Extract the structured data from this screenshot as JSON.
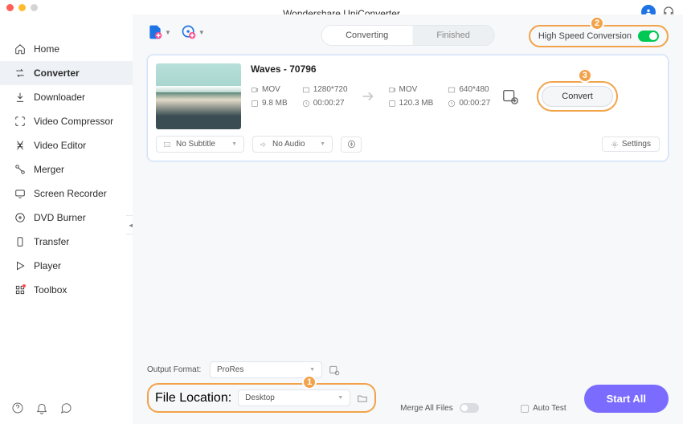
{
  "app": {
    "title": "Wondershare UniConverter"
  },
  "sidebar": {
    "items": [
      {
        "label": "Home"
      },
      {
        "label": "Converter"
      },
      {
        "label": "Downloader"
      },
      {
        "label": "Video Compressor"
      },
      {
        "label": "Video Editor"
      },
      {
        "label": "Merger"
      },
      {
        "label": "Screen Recorder"
      },
      {
        "label": "DVD Burner"
      },
      {
        "label": "Transfer"
      },
      {
        "label": "Player"
      },
      {
        "label": "Toolbox"
      }
    ]
  },
  "tabs": {
    "converting": "Converting",
    "finished": "Finished"
  },
  "hsc": {
    "label": "High Speed Conversion"
  },
  "file": {
    "name": "Waves - 70796",
    "src": {
      "format": "MOV",
      "resolution": "1280*720",
      "size": "9.8 MB",
      "duration": "00:00:27"
    },
    "dst": {
      "format": "MOV",
      "resolution": "640*480",
      "size": "120.3 MB",
      "duration": "00:00:27"
    },
    "subtitle": "No Subtitle",
    "audio": "No Audio",
    "settings": "Settings",
    "convert": "Convert"
  },
  "footer": {
    "output_label": "Output Format:",
    "output_value": "ProRes",
    "location_label": "File Location:",
    "location_value": "Desktop",
    "merge": "Merge All Files",
    "autotest": "Auto Test",
    "startall": "Start All"
  },
  "badges": {
    "b1": "1",
    "b2": "2",
    "b3": "3"
  }
}
